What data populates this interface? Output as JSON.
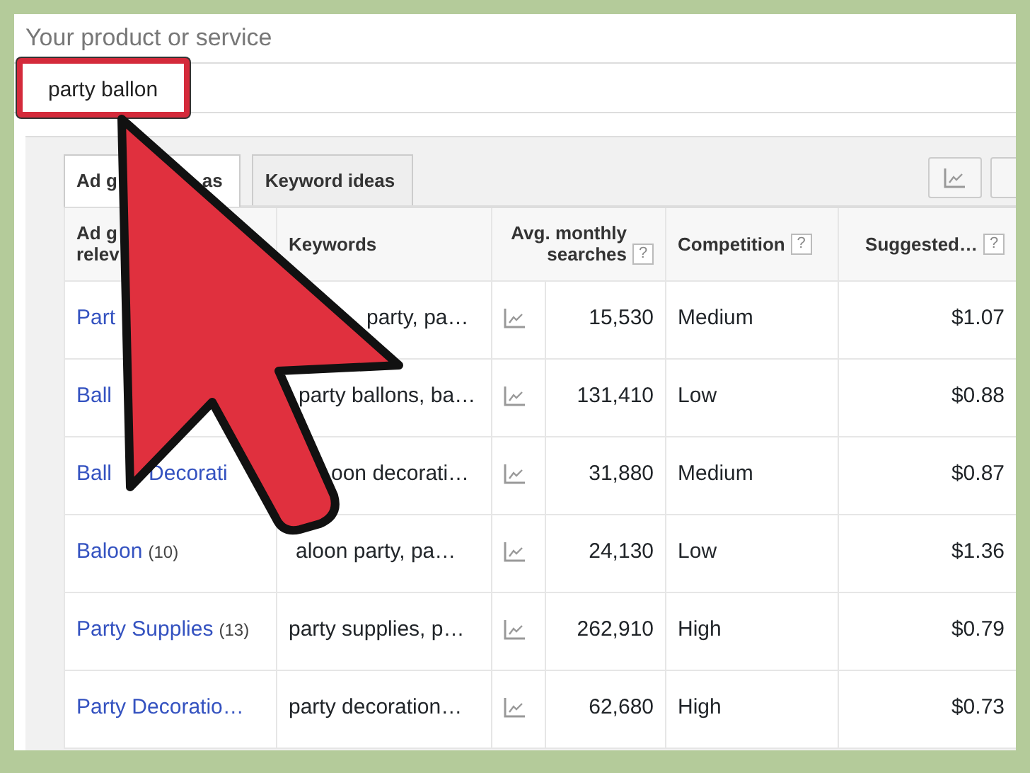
{
  "field": {
    "label": "Your product or service",
    "value": "party ballon",
    "highlighted": true
  },
  "tabs": [
    {
      "parts": [
        "Ad g",
        "as"
      ],
      "selected": true
    },
    {
      "parts": [
        "Keyword ideas"
      ],
      "selected": false
    }
  ],
  "table": {
    "columns": [
      {
        "lines": [
          "Ad g",
          "relev"
        ]
      },
      {
        "lines": [
          "Keywords"
        ]
      },
      {
        "lines": [
          "Avg. monthly",
          "searches"
        ],
        "help": "?"
      },
      {
        "lines": [
          "Competition"
        ],
        "help": "?"
      },
      {
        "lines": [
          "Suggested…"
        ],
        "help": "?"
      }
    ],
    "rows": [
      {
        "group": [
          "Part"
        ],
        "keywords": "party, pa…",
        "searches": "15,530",
        "competition": "Medium",
        "bid": "$1.07"
      },
      {
        "group": [
          "Ball"
        ],
        "keywords": "party ballons, ba…",
        "searches": "131,410",
        "competition": "Low",
        "bid": "$0.88"
      },
      {
        "group": [
          "Ball",
          "Decorati"
        ],
        "keywords": "oon decorati…",
        "searches": "31,880",
        "competition": "Medium",
        "bid": "$0.87"
      },
      {
        "group": [
          "Baloon"
        ],
        "count": "(10)",
        "keywords": "aloon party, pa…",
        "searches": "24,130",
        "competition": "Low",
        "bid": "$1.36"
      },
      {
        "group": [
          "Party Supplies"
        ],
        "count": "(13)",
        "keywords": "party supplies, p…",
        "searches": "262,910",
        "competition": "High",
        "bid": "$0.79"
      },
      {
        "group": [
          "Party Decoratio…"
        ],
        "keywords": "party decoration…",
        "searches": "62,680",
        "competition": "High",
        "bid": "$0.73"
      }
    ]
  }
}
